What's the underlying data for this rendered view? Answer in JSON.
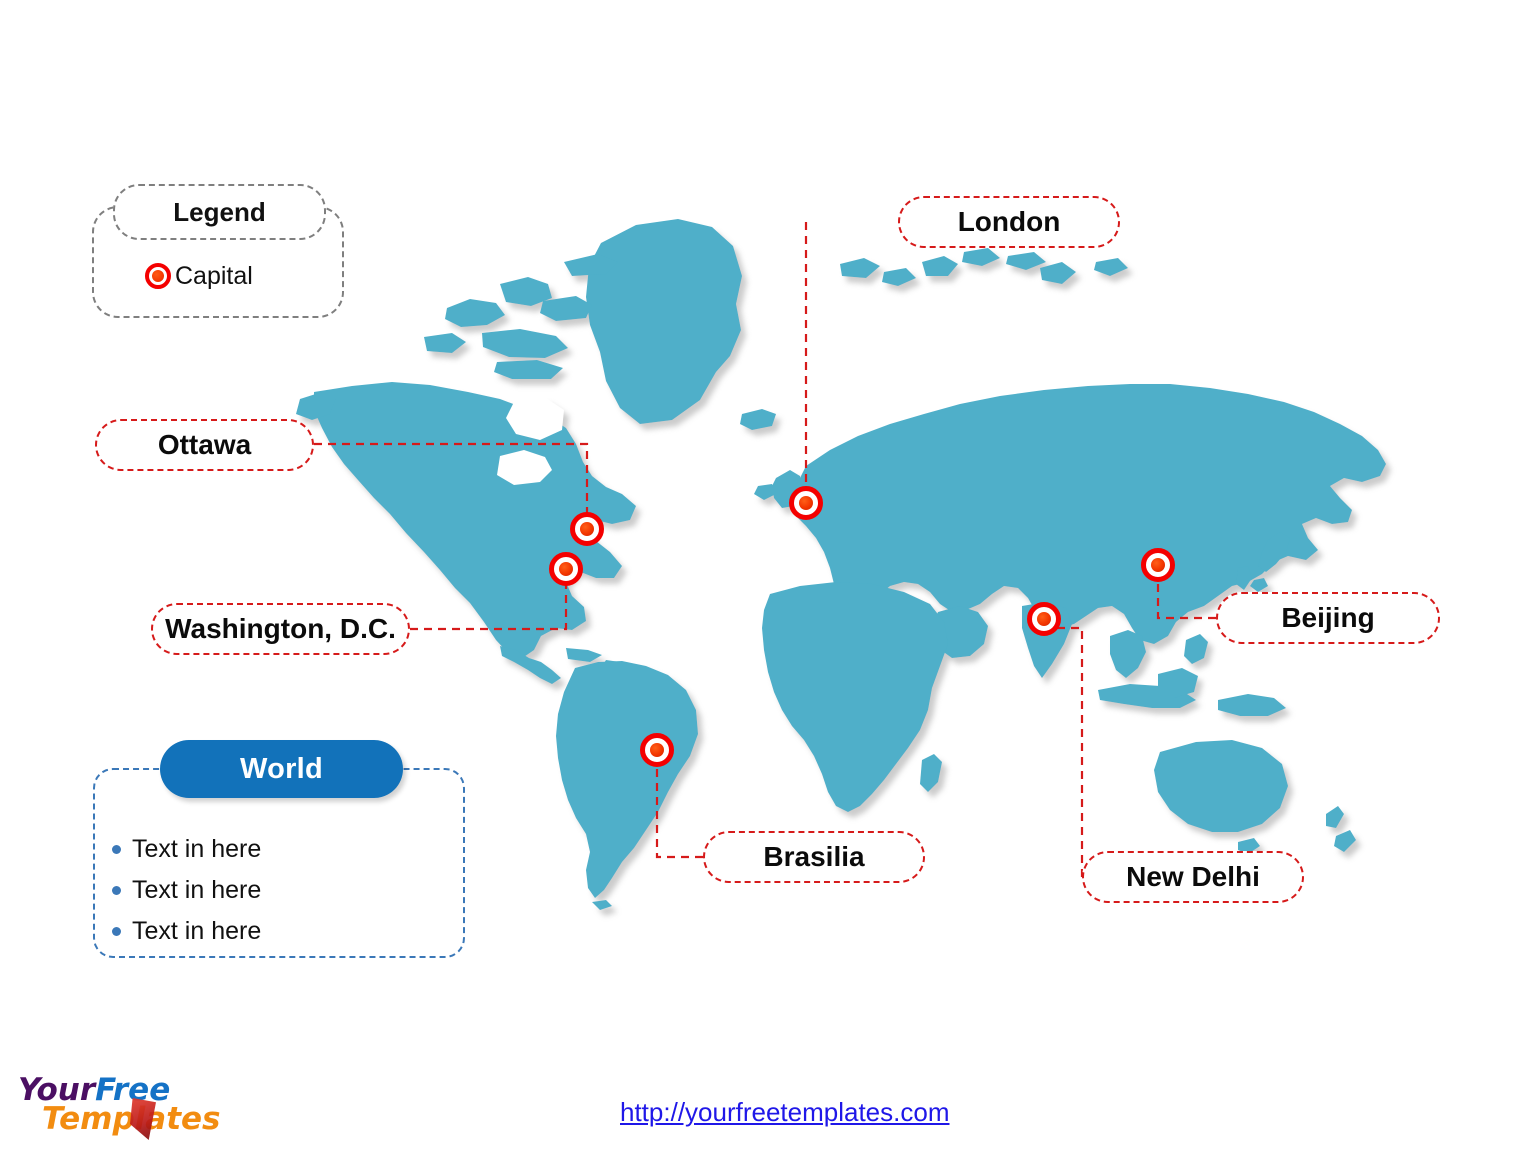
{
  "legend": {
    "title": "Legend",
    "items": [
      {
        "icon": "capital-marker-icon",
        "label": "Capital"
      }
    ]
  },
  "info_panel": {
    "title": "World",
    "bullets": [
      {
        "text": "Text in here"
      },
      {
        "text": "Text in here"
      },
      {
        "text": "Text in here"
      }
    ]
  },
  "map": {
    "land_color": "#4fafc9",
    "shadow_color": "#d9d9d9",
    "background_color": "#ffffff",
    "marker_ring_color": "#f40000",
    "marker_fill_color": "#f33600",
    "connector_color": "#d61a1a",
    "callout_border_color": "#d61a1a",
    "callouts": [
      {
        "name": "London",
        "label": "London"
      },
      {
        "name": "Ottawa",
        "label": "Ottawa"
      },
      {
        "name": "Washington, D.C.",
        "label": "Washington, D.C."
      },
      {
        "name": "Beijing",
        "label": "Beijing"
      },
      {
        "name": "Brasilia",
        "label": "Brasilia"
      },
      {
        "name": "New Delhi",
        "label": "New Delhi"
      }
    ]
  },
  "footer": {
    "logo": {
      "part1": "Your",
      "part2": "Free",
      "part3": "Templates"
    },
    "url": "http://yourfreetemplates.com"
  }
}
